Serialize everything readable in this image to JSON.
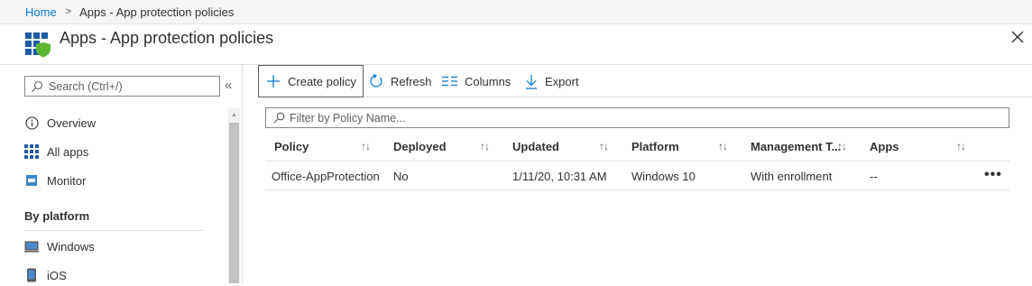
{
  "breadcrumb": {
    "home": "Home",
    "separator": ">",
    "current": "Apps - App protection policies"
  },
  "header": {
    "title": "Apps - App protection policies",
    "icon": "grid-shield-icon"
  },
  "sidebar": {
    "search_placeholder": "Search (Ctrl+/)",
    "collapse_glyph": "«",
    "items": [
      {
        "label": "Overview",
        "icon": "info-icon"
      },
      {
        "label": "All apps",
        "icon": "apps-grid-icon"
      },
      {
        "label": "Monitor",
        "icon": "monitor-icon"
      }
    ],
    "section": "By platform",
    "platform_items": [
      {
        "label": "Windows",
        "icon": "windows-device-icon"
      },
      {
        "label": "iOS",
        "icon": "ios-device-icon"
      }
    ]
  },
  "toolbar": {
    "create": "Create policy",
    "refresh": "Refresh",
    "columns": "Columns",
    "export": "Export"
  },
  "filter": {
    "placeholder": "Filter by Policy Name..."
  },
  "table": {
    "columns": [
      "Policy",
      "Deployed",
      "Updated",
      "Platform",
      "Management T...",
      "Apps"
    ],
    "sort_glyph": "↑↓",
    "rows": [
      [
        "Office-AppProtection",
        "No",
        "1/11/20, 10:31 AM",
        "Windows 10",
        "With enrollment",
        "--"
      ]
    ],
    "row_menu": "•••"
  },
  "colors": {
    "accent": "#0078d4",
    "icon_blue": "#1e5aa8",
    "shield_green": "#5fb832",
    "border": "#e1dfdd"
  }
}
